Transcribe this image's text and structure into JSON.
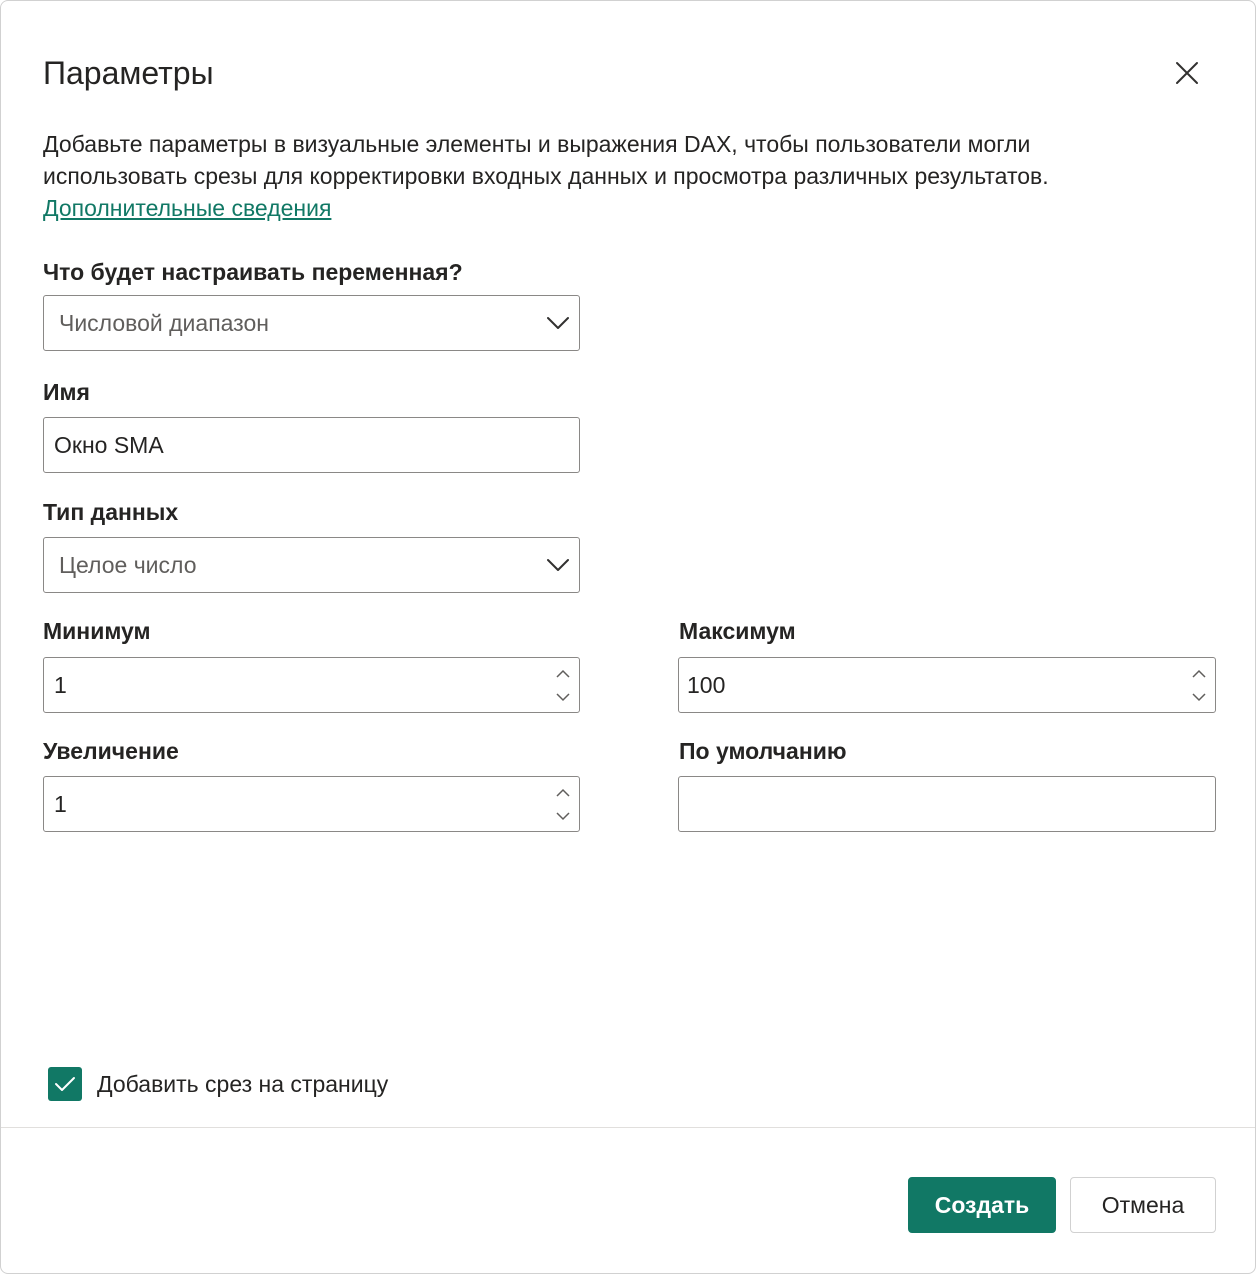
{
  "dialog": {
    "title": "Параметры",
    "close_icon": "close-icon",
    "description_line1": "Добавьте параметры в визуальные элементы и выражения DAX, чтобы пользователи могли",
    "description_line2": "использовать срезы для корректировки входных данных и просмотра различных результатов.",
    "learn_more_link": "Дополнительные сведения"
  },
  "form": {
    "variable_type": {
      "label": "Что будет настраивать переменная?",
      "value": "Числовой диапазон"
    },
    "name": {
      "label": "Имя",
      "value": "Окно SMA"
    },
    "data_type": {
      "label": "Тип данных",
      "value": "Целое число"
    },
    "minimum": {
      "label": "Минимум",
      "value": "1"
    },
    "maximum": {
      "label": "Максимум",
      "value": "100"
    },
    "increment": {
      "label": "Увеличение",
      "value": "1"
    },
    "default": {
      "label": "По умолчанию",
      "value": ""
    },
    "add_slicer": {
      "label": "Добавить срез на страницу",
      "checked": true
    }
  },
  "footer": {
    "create_label": "Создать",
    "cancel_label": "Отмена"
  },
  "colors": {
    "accent": "#117865",
    "text": "#252423",
    "border": "#8a8886"
  }
}
